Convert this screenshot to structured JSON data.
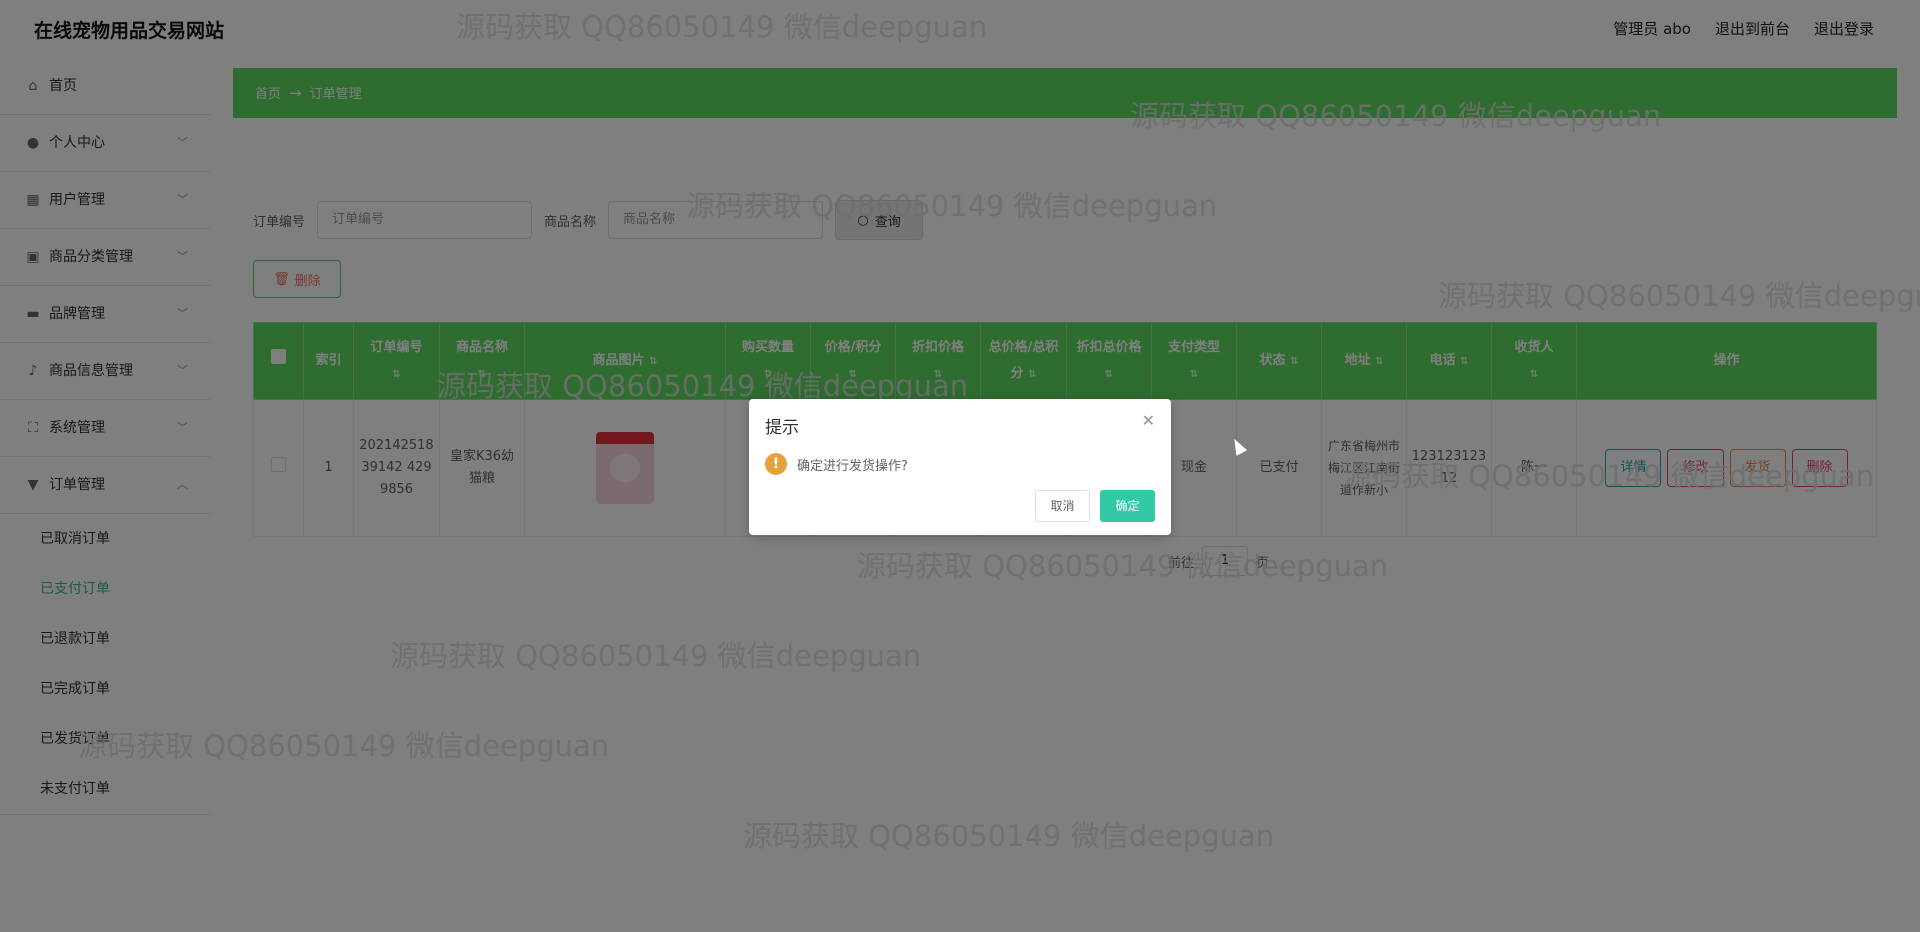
{
  "header": {
    "site_title": "在线宠物用品交易网站",
    "admin_label": "管理员 abo",
    "back_to_front": "退出到前台",
    "logout": "退出登录"
  },
  "sidebar": {
    "items": [
      {
        "label": "首页",
        "icon": "home-icon"
      },
      {
        "label": "个人中心",
        "icon": "user-icon"
      },
      {
        "label": "用户管理",
        "icon": "grid-icon"
      },
      {
        "label": "商品分类管理",
        "icon": "box-icon"
      },
      {
        "label": "品牌管理",
        "icon": "briefcase-icon"
      },
      {
        "label": "商品信息管理",
        "icon": "microphone-icon"
      },
      {
        "label": "系统管理",
        "icon": "fullscreen-icon"
      },
      {
        "label": "订单管理",
        "icon": "stamp-icon"
      }
    ],
    "order_sub_items": [
      "已取消订单",
      "已支付订单",
      "已退款订单",
      "已完成订单",
      "已发货订单",
      "未支付订单"
    ],
    "active_sub_item": "已支付订单"
  },
  "breadcrumb": {
    "home": "首页",
    "arrow": "→",
    "current": "订单管理"
  },
  "search": {
    "order_no_label": "订单编号",
    "order_no_placeholder": "订单编号",
    "product_name_label": "商品名称",
    "product_name_placeholder": "商品名称",
    "query_button": "查询"
  },
  "toolbar": {
    "delete_button": "删除"
  },
  "table": {
    "headers": [
      "索引",
      "订单编号",
      "商品名称",
      "商品图片",
      "购买数量",
      "价格/积分",
      "折扣价格",
      "总价格/总积分",
      "折扣总价格",
      "支付类型",
      "状态",
      "地址",
      "电话",
      "收货人",
      "操作"
    ],
    "rows": [
      {
        "index": "1",
        "order_no": "20214251839142 4299856",
        "product_name": "皇家K36幼猫粮",
        "quantity": "",
        "price": "",
        "discount_price": "",
        "total_price": "",
        "discount_total": "",
        "payment_type": "现金",
        "status": "已支付",
        "address": "广东省梅州市梅江区江南街道作新小",
        "phone": "12312312312",
        "receiver": "陈一"
      }
    ],
    "actions": {
      "detail": "详情",
      "edit": "修改",
      "ship": "发货",
      "delete": "删除"
    }
  },
  "pagination": {
    "goto_label": "前往",
    "page": "1",
    "page_suffix": "页"
  },
  "dialog": {
    "title": "提示",
    "message": "确定进行发货操作?",
    "cancel": "取消",
    "confirm": "确定"
  },
  "watermark_text": "源码获取 QQ86050149 微信deepguan",
  "colors": {
    "brand_green": "#5cd95e",
    "confirm_teal": "#33c9a5",
    "warning": "#e6a23c",
    "active_menu": "#3ab58e"
  }
}
